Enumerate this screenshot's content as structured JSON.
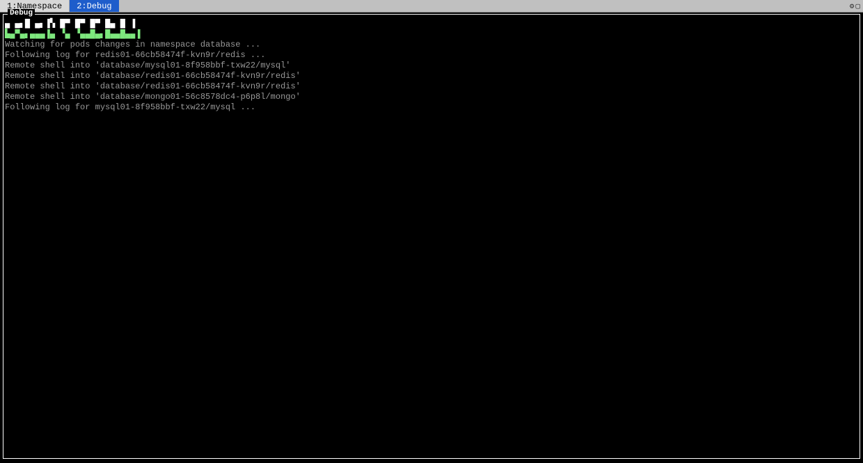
{
  "tabs": [
    {
      "label": "1:Namespace",
      "active": false
    },
    {
      "label": "2:Debug",
      "active": true
    }
  ],
  "panel": {
    "title": "Debug"
  },
  "ascii": {
    "line1": "▄ ▄▖█ ▄▖▐▚ █▀ █▀ █▀ █▄ █ ▐",
    "line2": "▙▄▀▄▖▄▄▄▐▄ ▝▄ ▝▄▄█▄▖█▄▄█▄▄▐"
  },
  "logs": [
    "Watching for pods changes in namespace database ...",
    "Following log for redis01-66cb58474f-kvn9r/redis ...",
    "Remote shell into 'database/mysql01-8f958bbf-txw22/mysql'",
    "Remote shell into 'database/redis01-66cb58474f-kvn9r/redis'",
    "Remote shell into 'database/redis01-66cb58474f-kvn9r/redis'",
    "Remote shell into 'database/mongo01-56c8578dc4-p6p8l/mongo'",
    "Following log for mysql01-8f958bbf-txw22/mysql ..."
  ],
  "toolbar": {
    "gear": "⚙",
    "maximize": "▢"
  }
}
